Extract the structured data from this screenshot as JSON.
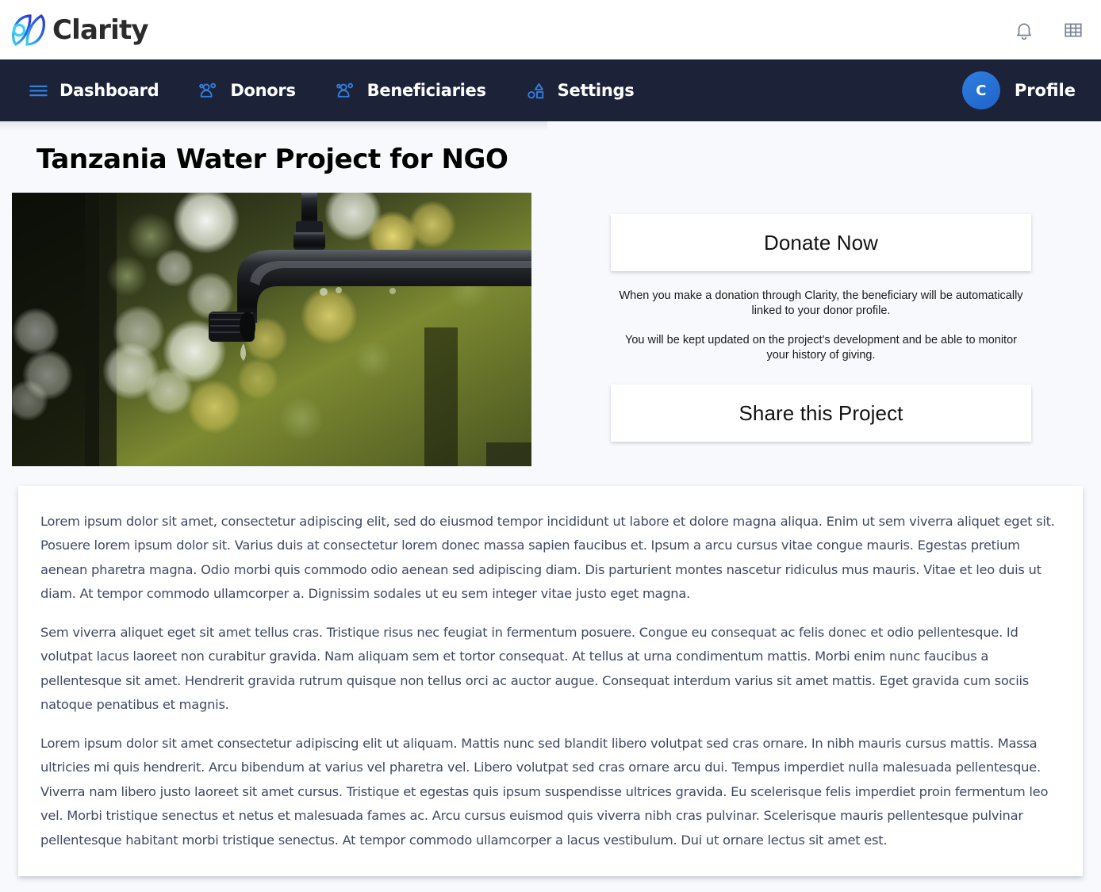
{
  "brand": {
    "name": "Clarity",
    "logo_icon": "clarity-butterfly-logo",
    "notifications_icon": "bell-icon",
    "apps_icon": "grid-apps-icon",
    "accent": "#2f7fe0",
    "logo_gradient_from": "#3ad0f5",
    "logo_gradient_to": "#2b36c8"
  },
  "nav": {
    "background": "#1c2238",
    "icon_color": "#2f7fe0",
    "items": [
      {
        "label": "Dashboard",
        "icon": "hamburger-menu-icon"
      },
      {
        "label": "Donors",
        "icon": "people-group-icon"
      },
      {
        "label": "Beneficiaries",
        "icon": "people-group-icon"
      },
      {
        "label": "Settings",
        "icon": "shapes-icon"
      }
    ],
    "profile": {
      "label": "Profile",
      "initial": "C"
    }
  },
  "main": {
    "title": "Tanzania Water Project for NGO",
    "hero_image": {
      "alt": "dripping-faucet-photo",
      "description": "Close-up of a dark metal outdoor tap dripping water against a green and yellow bokeh background"
    },
    "actions": {
      "donate_label": "Donate Now",
      "share_label": "Share this Project",
      "blurb_1": "When you make a donation through Clarity, the beneficiary will be automatically linked to your donor profile.",
      "blurb_2": "You will be kept updated on the project's development and be able to monitor your history of giving."
    },
    "body_paragraphs": [
      "Lorem ipsum dolor sit amet, consectetur adipiscing elit, sed do eiusmod tempor incididunt ut labore et dolore magna aliqua. Enim ut sem viverra aliquet eget sit. Posuere lorem ipsum dolor sit. Varius duis at consectetur lorem donec massa sapien faucibus et. Ipsum a arcu cursus vitae congue mauris. Egestas pretium aenean pharetra magna. Odio morbi quis commodo odio aenean sed adipiscing diam. Dis parturient montes nascetur ridiculus mus mauris. Vitae et leo duis ut diam. At tempor commodo ullamcorper a. Dignissim sodales ut eu sem integer vitae justo eget magna.",
      "Sem viverra aliquet eget sit amet tellus cras. Tristique risus nec feugiat in fermentum posuere. Congue eu consequat ac felis donec et odio pellentesque. Id volutpat lacus laoreet non curabitur gravida. Nam aliquam sem et tortor consequat. At tellus at urna condimentum mattis. Morbi enim nunc faucibus a pellentesque sit amet. Hendrerit gravida rutrum quisque non tellus orci ac auctor augue. Consequat interdum varius sit amet mattis. Eget gravida cum sociis natoque penatibus et magnis.",
      "Lorem ipsum dolor sit amet consectetur adipiscing elit ut aliquam. Mattis nunc sed blandit libero volutpat sed cras ornare. In nibh mauris cursus mattis. Massa ultricies mi quis hendrerit. Arcu bibendum at varius vel pharetra vel. Libero volutpat sed cras ornare arcu dui. Tempus imperdiet nulla malesuada pellentesque. Viverra nam libero justo laoreet sit amet cursus. Tristique et egestas quis ipsum suspendisse ultrices gravida. Eu scelerisque felis imperdiet proin fermentum leo vel. Morbi tristique senectus et netus et malesuada fames ac. Arcu cursus euismod quis viverra nibh cras pulvinar. Scelerisque mauris pellentesque pulvinar pellentesque habitant morbi tristique senectus. At tempor commodo ullamcorper a lacus vestibulum. Dui ut ornare lectus sit amet est."
    ]
  }
}
